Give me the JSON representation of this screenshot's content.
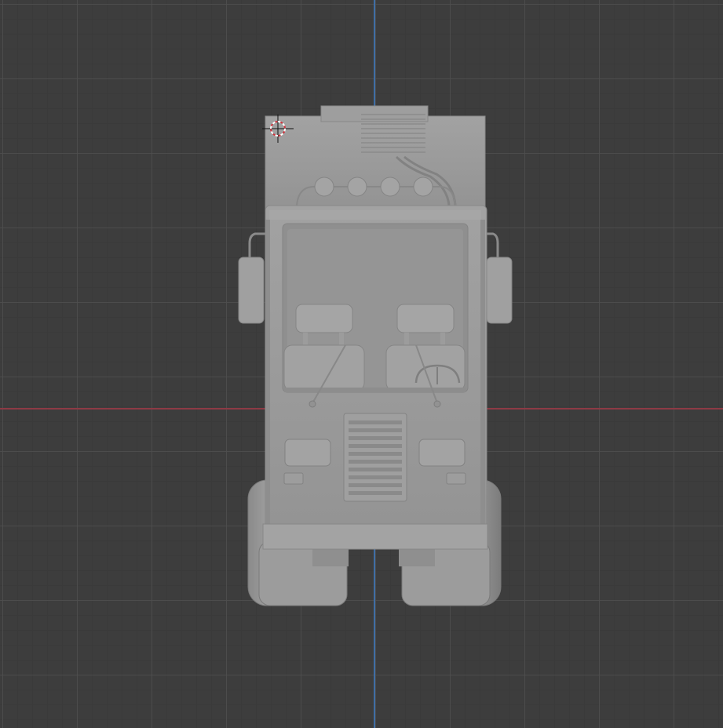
{
  "viewport": {
    "background": "#3d3d3d",
    "grid_minor": "#3a3a3a",
    "grid_major": "#4e4e4e",
    "axis_x_color": "#8e3a45",
    "axis_y_color": "#3f6ea6"
  },
  "model": {
    "object": "truck-front-view",
    "material_color": "#9a9a9a"
  },
  "cursor_3d": {
    "icon": "3d-cursor-icon"
  }
}
